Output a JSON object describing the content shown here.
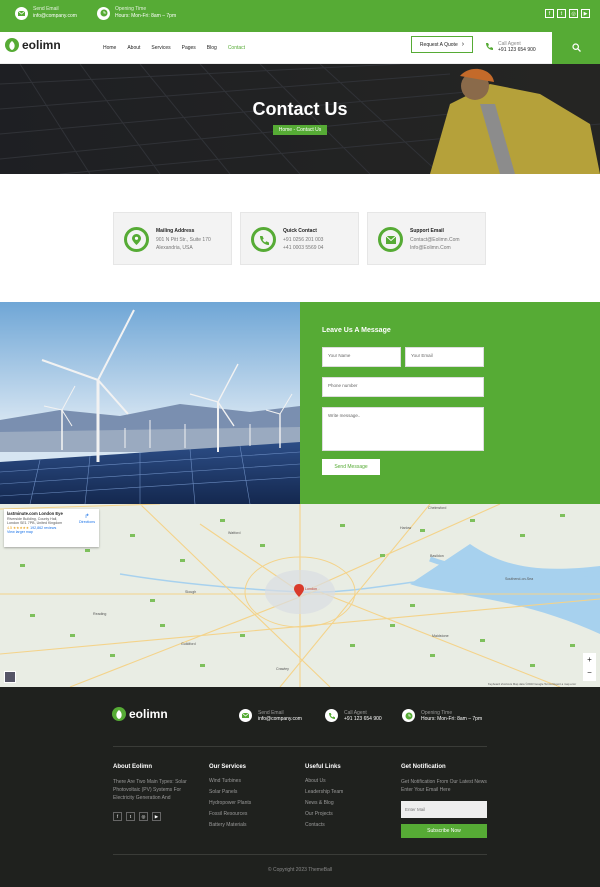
{
  "topbar": {
    "email_label": "Send Email",
    "email": "info@company.com",
    "hours_label": "Opening Time",
    "hours": "Hours: Mon-Fri: 8am – 7pm",
    "social": [
      "f",
      "t",
      "ig",
      "yt"
    ]
  },
  "nav": {
    "logo": "eolimn",
    "menu": [
      "Home",
      "About",
      "Services",
      "Pages",
      "Blog",
      "Contact"
    ],
    "quote": "Request A Quote",
    "agent_label": "Call Agent",
    "agent_phone": "+91 123 654 900"
  },
  "hero": {
    "title": "Contact Us",
    "breadcrumb": "Home - Contact Us"
  },
  "cards": [
    {
      "title": "Mailing Address",
      "line1": "901 N Pitt Str., Suite 170",
      "line2": "Alexandria, USA",
      "icon": "location-icon"
    },
    {
      "title": "Quick Contact",
      "line1": "+91 0256 201 003",
      "line2": "+41 0003 5569 04",
      "icon": "phone-icon"
    },
    {
      "title": "Support Email",
      "line1": "Contact@Eolimn.Com",
      "line2": "Info@Eolimn.Com",
      "icon": "mail-icon"
    }
  ],
  "form": {
    "title": "Leave Us A Message",
    "name": "Your Name",
    "email": "Your Email",
    "phone": "Phone number",
    "message": "Write message..",
    "submit": "Send Message"
  },
  "map": {
    "place": "lastminute.com London Eye",
    "address": "Riverside Building, County Hall, London SE1 7PB, United Kingdom",
    "rating": "4.5 ★★★★★",
    "reviews": "192,862 reviews",
    "larger": "View larger map",
    "directions": "Directions",
    "labels": [
      "Watford",
      "Harlow",
      "Chelmsford",
      "Southend-on-Sea",
      "Slough",
      "London",
      "Reading",
      "Guildford",
      "Maidstone",
      "Basildon",
      "Crawley"
    ],
    "footer": "Keyboard shortcuts   Map data ©2023 Google   Terms   Report a map error"
  },
  "footer": {
    "logo": "eolimn",
    "email_label": "Send Email",
    "email": "info@company.com",
    "agent_label": "Call Agent",
    "agent": "+91 123 654 900",
    "hours_label": "Opening Time",
    "hours": "Hours: Mon-Fri: 8am – 7pm",
    "about_title": "About Eolimn",
    "about_text": "There Are Two Main Types: Solar Photovoltaic (PV) Systems For Electricity Generation And",
    "services_title": "Our Services",
    "services": [
      "Wind Turbines",
      "Solar Panels",
      "Hydropower Plants",
      "Fossil Resources",
      "Battery Materials"
    ],
    "links_title": "Useful Links",
    "links": [
      "About Us",
      "Leadership Team",
      "News & Blog",
      "Our Projects",
      "Contacts"
    ],
    "notif_title": "Get Notification",
    "notif_text": "Get Notification From Our Latest News Enter Your Email Here",
    "mail_placeholder": "Enter Mail",
    "subscribe": "Subscribe Now",
    "copyright": "© Copyright 2023 ThemeBall"
  }
}
